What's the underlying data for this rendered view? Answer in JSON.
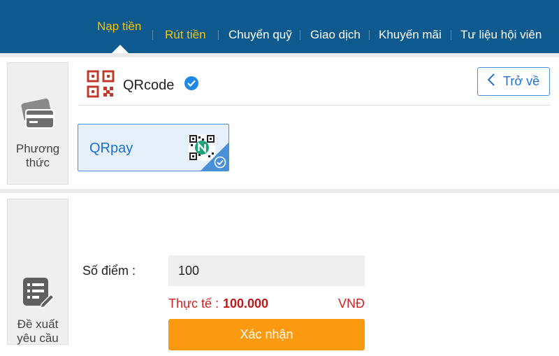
{
  "nav": {
    "items": [
      {
        "label": "Nạp tiền"
      },
      {
        "label": "Rút tiền"
      },
      {
        "label": "Chuyển quỹ"
      },
      {
        "label": "Giao dịch"
      },
      {
        "label": "Khuyến mãi"
      },
      {
        "label": "Tư liệu hội viên"
      }
    ]
  },
  "method_section": {
    "side_label": "Phương thức",
    "side_icon": "card-icon",
    "title": "QRcode",
    "back_label": "Trở về",
    "options": [
      {
        "label": "QRpay",
        "selected": true
      }
    ]
  },
  "request_section": {
    "side_label": "Đề xuất yêu cầu",
    "side_icon": "form-edit-icon",
    "points_label": "Số điểm :",
    "points_value": "100",
    "actual_label": "Thực tế :",
    "actual_amount": "100.000",
    "currency": "VNĐ",
    "confirm_label": "Xác nhận"
  },
  "colors": {
    "nav_bg": "#0e5a8f",
    "nav_highlight": "#f5c400",
    "accent_blue": "#1e6fd0",
    "confirm_orange": "#fb9a0e",
    "amount_red": "#d42020"
  }
}
